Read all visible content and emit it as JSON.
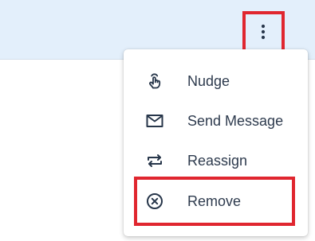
{
  "header": {
    "more_actions_icon": "more-vertical-icon"
  },
  "menu": {
    "items": [
      {
        "label": "Nudge",
        "icon": "hand-pointer-icon"
      },
      {
        "label": "Send Message",
        "icon": "envelope-icon"
      },
      {
        "label": "Reassign",
        "icon": "swap-arrows-icon"
      },
      {
        "label": "Remove",
        "icon": "remove-circle-icon"
      }
    ]
  },
  "colors": {
    "header_background": "#e3effb",
    "highlight_border": "#e0262f",
    "text": "#2e3b4e",
    "icon": "#27364a"
  }
}
